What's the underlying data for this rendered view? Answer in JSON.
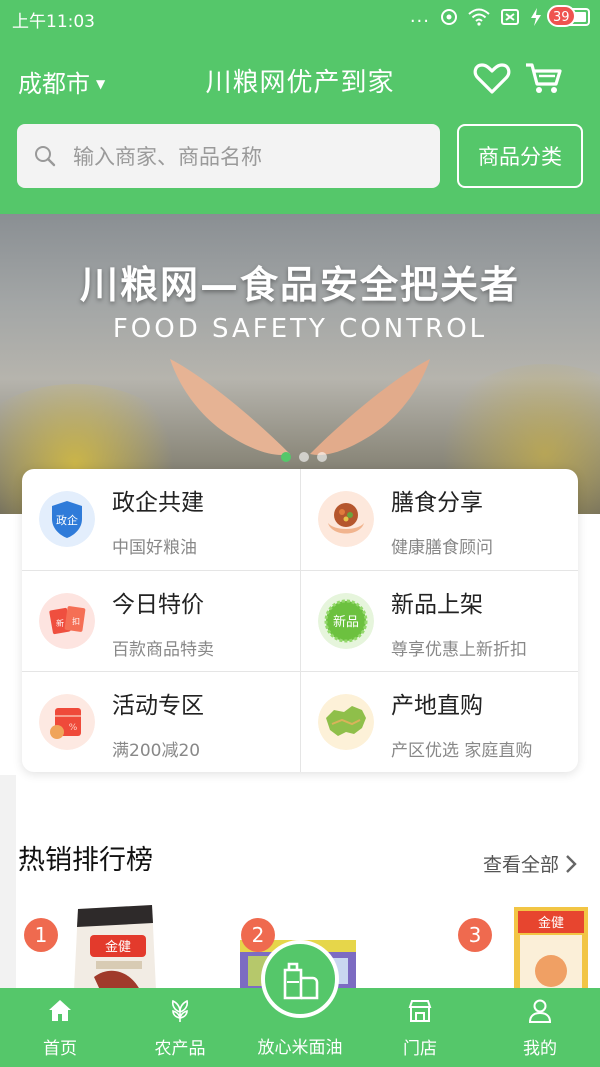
{
  "status_bar": {
    "time": "上午11:03",
    "dots": "..."
  },
  "header": {
    "city": "成都市",
    "title": "川粮网优产到家",
    "cart_count": "39"
  },
  "search": {
    "placeholder": "输入商家、商品名称",
    "category_button": "商品分类"
  },
  "banner": {
    "title": "川粮网—食品安全把关者",
    "subtitle": "FOOD SAFETY CONTROL"
  },
  "features": [
    {
      "title": "政企共建",
      "subtitle": "中国好粮油",
      "icon": "shield-icon",
      "icon_text": "政企"
    },
    {
      "title": "膳食分享",
      "subtitle": "健康膳食顾问",
      "icon": "food-bowl-icon"
    },
    {
      "title": "今日特价",
      "subtitle": "百款商品特卖",
      "icon": "red-envelope-icon",
      "icon_text": "新 扣"
    },
    {
      "title": "新品上架",
      "subtitle": "尊享优惠上新折扣",
      "icon": "new-badge-icon",
      "icon_text": "新品"
    },
    {
      "title": "活动专区",
      "subtitle": "满200减20",
      "icon": "gift-bag-icon"
    },
    {
      "title": "产地直购",
      "subtitle": "产区优选 家庭直购",
      "icon": "china-map-icon"
    }
  ],
  "hot": {
    "title": "热销排行榜",
    "see_all": "查看全部"
  },
  "products": [
    {
      "rank": "1",
      "brand": "金健"
    },
    {
      "rank": "2"
    },
    {
      "rank": "3",
      "brand": "金健"
    }
  ],
  "tabbar": [
    {
      "label": "首页",
      "icon": "home-icon"
    },
    {
      "label": "农产品",
      "icon": "leaf-icon"
    },
    {
      "label": "放心米面油",
      "icon": "oil-bottle-icon"
    },
    {
      "label": "门店",
      "icon": "store-icon"
    },
    {
      "label": "我的",
      "icon": "user-icon"
    }
  ],
  "colors": {
    "primary": "#55c76a",
    "badge": "#ef5350",
    "rank": "#ef6a4f"
  }
}
